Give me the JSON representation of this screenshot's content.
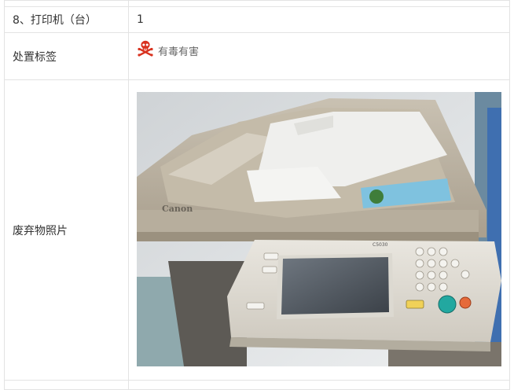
{
  "rows": [
    {
      "label": "8、打印机（台）",
      "value": "1"
    },
    {
      "label": "处置标签",
      "tag_text": "有毒有害",
      "tag_icon": "skull-crossbones-icon",
      "tag_color": "#d9321f"
    },
    {
      "label": "废弃物照片",
      "photo_caption": "Canon",
      "photo_model": "C5030"
    }
  ],
  "colors": {
    "border": "#e3e3e3",
    "text": "#333333",
    "tag_text": "#666666",
    "danger": "#d9321f"
  }
}
